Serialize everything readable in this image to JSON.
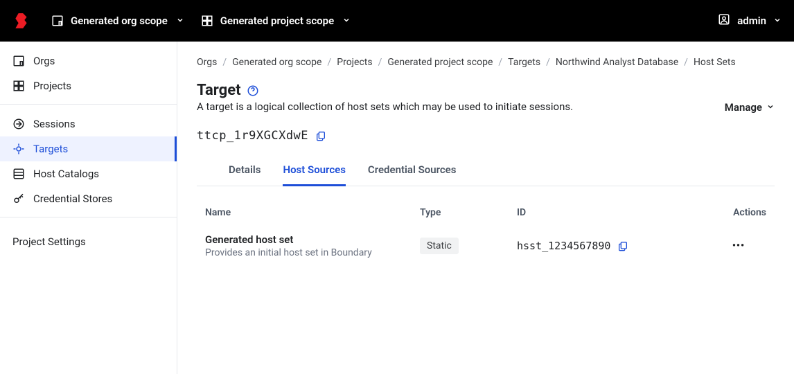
{
  "topbar": {
    "org_scope_label": "Generated org scope",
    "project_scope_label": "Generated project scope",
    "user_label": "admin"
  },
  "sidebar": {
    "group1": [
      {
        "key": "orgs",
        "label": "Orgs"
      },
      {
        "key": "projects",
        "label": "Projects"
      }
    ],
    "group2": [
      {
        "key": "sessions",
        "label": "Sessions"
      },
      {
        "key": "targets",
        "label": "Targets"
      },
      {
        "key": "host-catalogs",
        "label": "Host Catalogs"
      },
      {
        "key": "credential-stores",
        "label": "Credential Stores"
      }
    ],
    "settings_label": "Project Settings"
  },
  "breadcrumb": {
    "items": [
      "Orgs",
      "Generated org scope",
      "Projects",
      "Generated project scope",
      "Targets",
      "Northwind Analyst Database",
      "Host Sets"
    ]
  },
  "page": {
    "title": "Target",
    "description": "A target is a logical collection of host sets which may be used to initiate sessions.",
    "id_code": "ttcp_1r9XGCXdwE",
    "manage_label": "Manage"
  },
  "tabs": [
    {
      "key": "details",
      "label": "Details"
    },
    {
      "key": "host-sources",
      "label": "Host Sources"
    },
    {
      "key": "credential-sources",
      "label": "Credential Sources"
    }
  ],
  "table": {
    "headers": {
      "name": "Name",
      "type": "Type",
      "id": "ID",
      "actions": "Actions"
    },
    "rows": [
      {
        "name": "Generated host set",
        "desc": "Provides an initial host set in Boundary",
        "type": "Static",
        "id": "hsst_1234567890"
      }
    ]
  }
}
